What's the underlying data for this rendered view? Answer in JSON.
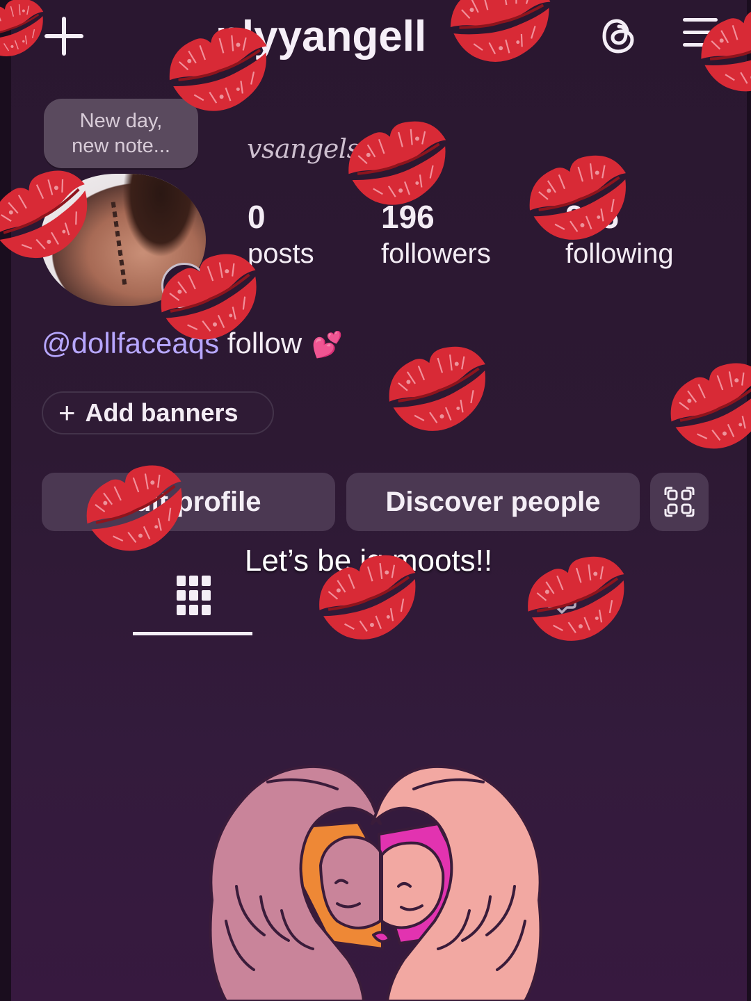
{
  "header": {
    "username": "nlyyangell",
    "new_post_icon": "plus-icon",
    "account_switch_icon": "chevron-down-icon",
    "threads_icon": "threads-icon",
    "menu_icon": "hamburger-menu-icon"
  },
  "note": {
    "line1": "New day,",
    "line2": "new note..."
  },
  "profile": {
    "full_name": "vsangels",
    "bio_mention": "@dollfaceaqs",
    "bio_text": " follow",
    "bio_emoji": "💕"
  },
  "stats": [
    {
      "value": "0",
      "label": "posts"
    },
    {
      "value": "196",
      "label": "followers"
    },
    {
      "value": "225",
      "label": "following"
    }
  ],
  "actions": {
    "add_banners": "Add banners",
    "add_banners_icon": "+",
    "edit_profile": "Edit profile",
    "discover_people": "Discover people",
    "qr_icon": "qr-code-icon"
  },
  "tabs": {
    "grid_icon": "grid-icon",
    "tagged_icon": "tagged-icon",
    "active": "grid"
  },
  "overlay": {
    "caption": "Let’s be ig moots!!",
    "sticker": "lips-kiss"
  },
  "colors": {
    "background": "#2c1832",
    "button": "#4b3852",
    "mention": "#b7a7ff",
    "kiss": "#d82a36"
  }
}
